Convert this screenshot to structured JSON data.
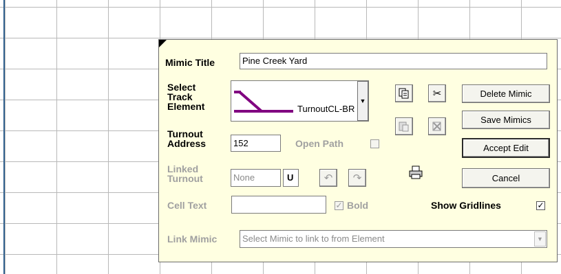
{
  "mimic_title": {
    "label": "Mimic Title",
    "value": "Pine Creek Yard"
  },
  "track_element": {
    "label_lines": [
      "Select",
      "Track",
      "Element"
    ],
    "selected": "TurnoutCL-BR",
    "color": "#800080"
  },
  "turnout_address": {
    "label_lines": [
      "Turnout",
      "Address"
    ],
    "value": "152"
  },
  "open_path": {
    "label": "Open Path",
    "checked": false
  },
  "linked_turnout": {
    "label_lines": [
      "Linked",
      "Turnout"
    ],
    "value": "None",
    "u_label": "U"
  },
  "cell_text": {
    "label": "Cell Text",
    "value": ""
  },
  "bold": {
    "label": "Bold",
    "checked": true
  },
  "show_gridlines": {
    "label": "Show Gridlines",
    "checked": true
  },
  "link_mimic": {
    "label": "Link Mimic",
    "placeholder": "Select Mimic to link to from Element"
  },
  "buttons": {
    "delete": "Delete Mimic",
    "save": "Save Mimics",
    "accept": "Accept Edit",
    "cancel": "Cancel"
  },
  "icons": [
    "copy-icon",
    "cut-icon",
    "paste-icon",
    "delete-element-icon",
    "undo-icon",
    "redo-icon",
    "print-icon"
  ],
  "check_glyph": "✓"
}
